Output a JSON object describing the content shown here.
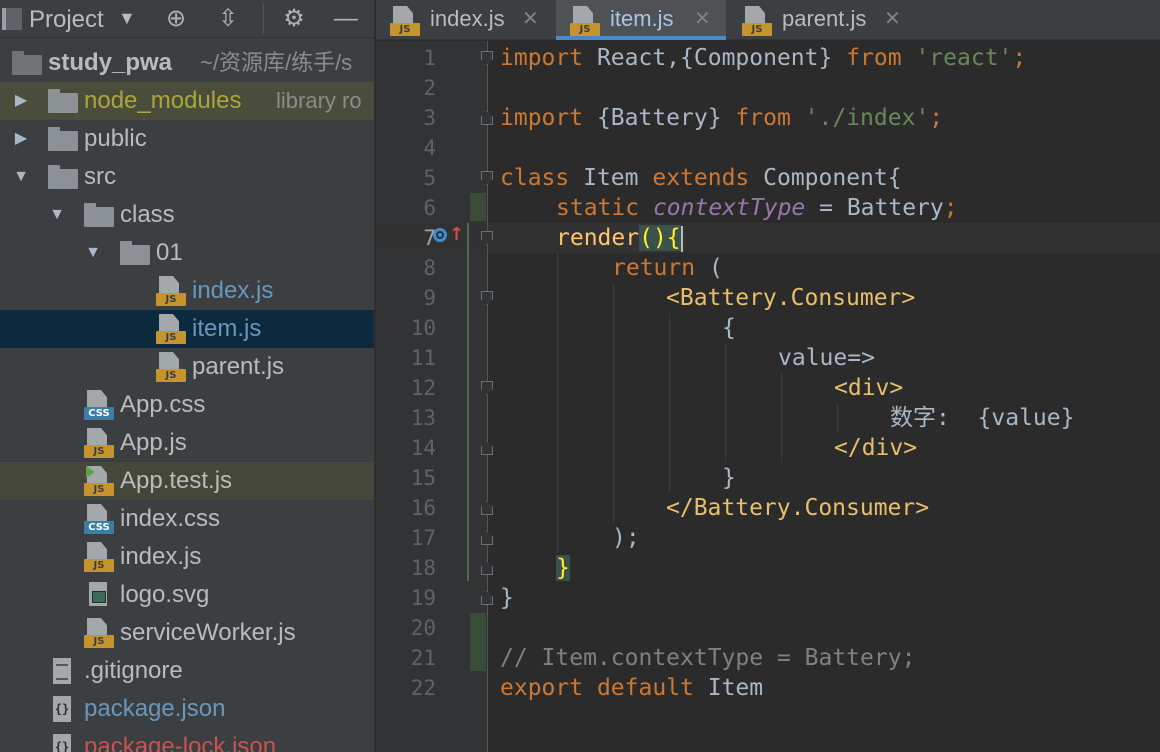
{
  "project_panel": {
    "title": "Project",
    "toolbar_icons": [
      "crosshair-icon",
      "collapse-icon",
      "gear-icon",
      "minimize-icon"
    ],
    "root": {
      "name": "study_pwa",
      "path_hint": "~/资源库/练手/s"
    },
    "tree": [
      {
        "name": "node_modules",
        "hint": "library ro",
        "type": "folder",
        "state": "collapsed"
      },
      {
        "name": "public",
        "type": "folder",
        "state": "collapsed"
      },
      {
        "name": "src",
        "type": "folder",
        "state": "expanded"
      },
      {
        "name": "class",
        "type": "folder",
        "state": "expanded"
      },
      {
        "name": "01",
        "type": "folder",
        "state": "expanded"
      },
      {
        "name": "index.js",
        "type": "js"
      },
      {
        "name": "item.js",
        "type": "js"
      },
      {
        "name": "parent.js",
        "type": "js"
      },
      {
        "name": "App.css",
        "type": "css"
      },
      {
        "name": "App.js",
        "type": "js"
      },
      {
        "name": "App.test.js",
        "type": "test"
      },
      {
        "name": "index.css",
        "type": "css"
      },
      {
        "name": "index.js",
        "type": "js"
      },
      {
        "name": "logo.svg",
        "type": "image"
      },
      {
        "name": "serviceWorker.js",
        "type": "js"
      },
      {
        "name": ".gitignore",
        "type": "text"
      },
      {
        "name": "package.json",
        "type": "json"
      },
      {
        "name": "package-lock.json",
        "type": "json"
      }
    ]
  },
  "editor": {
    "tabs": [
      {
        "label": "index.js",
        "active": false
      },
      {
        "label": "item.js",
        "active": true
      },
      {
        "label": "parent.js",
        "active": false
      }
    ],
    "badge_js": "JS",
    "badge_css": "CSS",
    "current_line": 7,
    "line_numbers": [
      "1",
      "2",
      "3",
      "4",
      "5",
      "6",
      "7",
      "8",
      "9",
      "10",
      "11",
      "12",
      "13",
      "14",
      "15",
      "16",
      "17",
      "18",
      "19",
      "20",
      "21",
      "22"
    ],
    "code": {
      "l1": {
        "kw1": "import",
        "t1": " React,{Component} ",
        "kw2": "from",
        "t2": " ",
        "str": "'react'",
        "kw3": ";"
      },
      "l3": {
        "kw1": "import",
        "t1": " {Battery} ",
        "kw2": "from",
        "t2": " ",
        "str": "'./index'",
        "kw3": ";"
      },
      "l5": {
        "kw1": "class",
        "t1": " Item ",
        "kw2": "extends",
        "t2": " Component{"
      },
      "l6": {
        "kw1": "static",
        "t1": " ",
        "fld": "contextType",
        "t2": " = Battery",
        "kw2": ";"
      },
      "l7": {
        "fn": "render",
        "br": "()",
        "br2": "{"
      },
      "l8": {
        "kw1": "return",
        "t1": " ("
      },
      "l9": {
        "tag": "<Battery.Consumer>"
      },
      "l10": {
        "t1": "{"
      },
      "l11": {
        "t1": "value=>"
      },
      "l12": {
        "tag": "<div>"
      },
      "l13": {
        "t1": "数字:  {value}"
      },
      "l14": {
        "tag": "</div>"
      },
      "l15": {
        "t1": "}"
      },
      "l16": {
        "tag": "</Battery.Consumer>"
      },
      "l17": {
        "t1": ");"
      },
      "l18": {
        "br": "}"
      },
      "l19": {
        "t1": "}"
      },
      "l21": {
        "cm": "// Item.contextType = Battery;"
      },
      "l22": {
        "kw1": "export",
        "t1": " ",
        "kw2": "default",
        "t2": " Item"
      }
    }
  }
}
